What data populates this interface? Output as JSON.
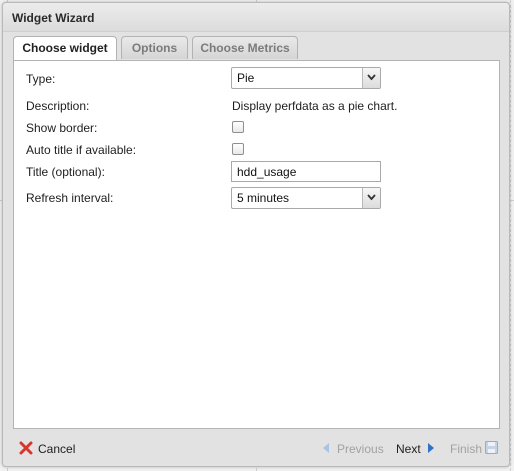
{
  "window": {
    "title": "Widget Wizard"
  },
  "tabs": [
    {
      "label": "Choose widget",
      "active": true
    },
    {
      "label": "Options",
      "active": false
    },
    {
      "label": "Choose Metrics",
      "active": false
    }
  ],
  "form": {
    "type_label": "Type:",
    "type_value": "Pie",
    "description_label": "Description:",
    "description_value": "Display perfdata as a pie chart.",
    "show_border_label": "Show border:",
    "show_border_checked": false,
    "auto_title_label": "Auto title if available:",
    "auto_title_checked": false,
    "title_label": "Title (optional):",
    "title_value": "hdd_usage",
    "refresh_label": "Refresh interval:",
    "refresh_value": "5 minutes"
  },
  "footer": {
    "cancel_label": "Cancel",
    "previous_label": "Previous",
    "next_label": "Next",
    "finish_label": "Finish"
  },
  "colors": {
    "cancel_icon": "#d9362b",
    "arrow_icon": "#2f72c7",
    "disabled_text": "#a2a2a2"
  }
}
